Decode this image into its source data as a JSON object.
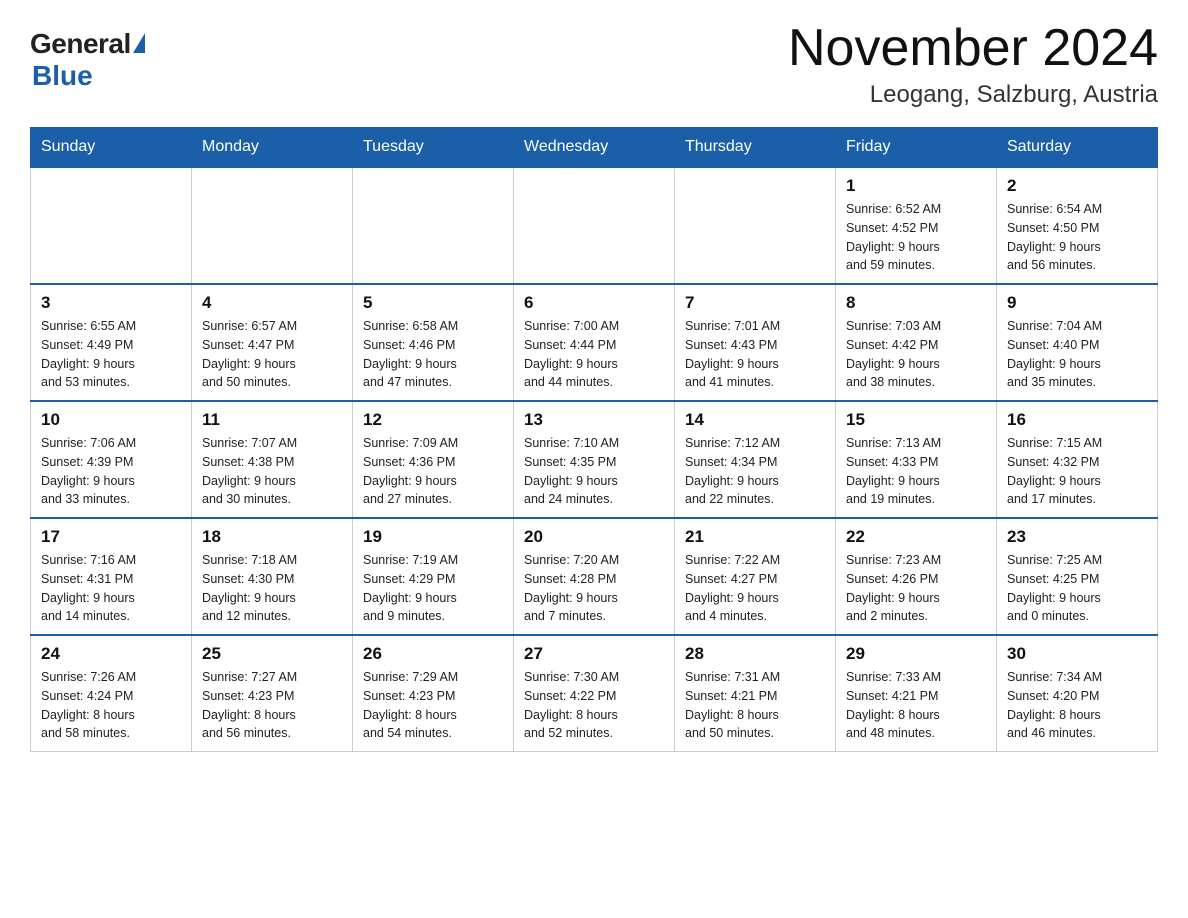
{
  "logo": {
    "general": "General",
    "triangle": "",
    "blue": "Blue"
  },
  "title": "November 2024",
  "location": "Leogang, Salzburg, Austria",
  "weekdays": [
    "Sunday",
    "Monday",
    "Tuesday",
    "Wednesday",
    "Thursday",
    "Friday",
    "Saturday"
  ],
  "weeks": [
    [
      {
        "day": "",
        "info": ""
      },
      {
        "day": "",
        "info": ""
      },
      {
        "day": "",
        "info": ""
      },
      {
        "day": "",
        "info": ""
      },
      {
        "day": "",
        "info": ""
      },
      {
        "day": "1",
        "info": "Sunrise: 6:52 AM\nSunset: 4:52 PM\nDaylight: 9 hours\nand 59 minutes."
      },
      {
        "day": "2",
        "info": "Sunrise: 6:54 AM\nSunset: 4:50 PM\nDaylight: 9 hours\nand 56 minutes."
      }
    ],
    [
      {
        "day": "3",
        "info": "Sunrise: 6:55 AM\nSunset: 4:49 PM\nDaylight: 9 hours\nand 53 minutes."
      },
      {
        "day": "4",
        "info": "Sunrise: 6:57 AM\nSunset: 4:47 PM\nDaylight: 9 hours\nand 50 minutes."
      },
      {
        "day": "5",
        "info": "Sunrise: 6:58 AM\nSunset: 4:46 PM\nDaylight: 9 hours\nand 47 minutes."
      },
      {
        "day": "6",
        "info": "Sunrise: 7:00 AM\nSunset: 4:44 PM\nDaylight: 9 hours\nand 44 minutes."
      },
      {
        "day": "7",
        "info": "Sunrise: 7:01 AM\nSunset: 4:43 PM\nDaylight: 9 hours\nand 41 minutes."
      },
      {
        "day": "8",
        "info": "Sunrise: 7:03 AM\nSunset: 4:42 PM\nDaylight: 9 hours\nand 38 minutes."
      },
      {
        "day": "9",
        "info": "Sunrise: 7:04 AM\nSunset: 4:40 PM\nDaylight: 9 hours\nand 35 minutes."
      }
    ],
    [
      {
        "day": "10",
        "info": "Sunrise: 7:06 AM\nSunset: 4:39 PM\nDaylight: 9 hours\nand 33 minutes."
      },
      {
        "day": "11",
        "info": "Sunrise: 7:07 AM\nSunset: 4:38 PM\nDaylight: 9 hours\nand 30 minutes."
      },
      {
        "day": "12",
        "info": "Sunrise: 7:09 AM\nSunset: 4:36 PM\nDaylight: 9 hours\nand 27 minutes."
      },
      {
        "day": "13",
        "info": "Sunrise: 7:10 AM\nSunset: 4:35 PM\nDaylight: 9 hours\nand 24 minutes."
      },
      {
        "day": "14",
        "info": "Sunrise: 7:12 AM\nSunset: 4:34 PM\nDaylight: 9 hours\nand 22 minutes."
      },
      {
        "day": "15",
        "info": "Sunrise: 7:13 AM\nSunset: 4:33 PM\nDaylight: 9 hours\nand 19 minutes."
      },
      {
        "day": "16",
        "info": "Sunrise: 7:15 AM\nSunset: 4:32 PM\nDaylight: 9 hours\nand 17 minutes."
      }
    ],
    [
      {
        "day": "17",
        "info": "Sunrise: 7:16 AM\nSunset: 4:31 PM\nDaylight: 9 hours\nand 14 minutes."
      },
      {
        "day": "18",
        "info": "Sunrise: 7:18 AM\nSunset: 4:30 PM\nDaylight: 9 hours\nand 12 minutes."
      },
      {
        "day": "19",
        "info": "Sunrise: 7:19 AM\nSunset: 4:29 PM\nDaylight: 9 hours\nand 9 minutes."
      },
      {
        "day": "20",
        "info": "Sunrise: 7:20 AM\nSunset: 4:28 PM\nDaylight: 9 hours\nand 7 minutes."
      },
      {
        "day": "21",
        "info": "Sunrise: 7:22 AM\nSunset: 4:27 PM\nDaylight: 9 hours\nand 4 minutes."
      },
      {
        "day": "22",
        "info": "Sunrise: 7:23 AM\nSunset: 4:26 PM\nDaylight: 9 hours\nand 2 minutes."
      },
      {
        "day": "23",
        "info": "Sunrise: 7:25 AM\nSunset: 4:25 PM\nDaylight: 9 hours\nand 0 minutes."
      }
    ],
    [
      {
        "day": "24",
        "info": "Sunrise: 7:26 AM\nSunset: 4:24 PM\nDaylight: 8 hours\nand 58 minutes."
      },
      {
        "day": "25",
        "info": "Sunrise: 7:27 AM\nSunset: 4:23 PM\nDaylight: 8 hours\nand 56 minutes."
      },
      {
        "day": "26",
        "info": "Sunrise: 7:29 AM\nSunset: 4:23 PM\nDaylight: 8 hours\nand 54 minutes."
      },
      {
        "day": "27",
        "info": "Sunrise: 7:30 AM\nSunset: 4:22 PM\nDaylight: 8 hours\nand 52 minutes."
      },
      {
        "day": "28",
        "info": "Sunrise: 7:31 AM\nSunset: 4:21 PM\nDaylight: 8 hours\nand 50 minutes."
      },
      {
        "day": "29",
        "info": "Sunrise: 7:33 AM\nSunset: 4:21 PM\nDaylight: 8 hours\nand 48 minutes."
      },
      {
        "day": "30",
        "info": "Sunrise: 7:34 AM\nSunset: 4:20 PM\nDaylight: 8 hours\nand 46 minutes."
      }
    ]
  ]
}
